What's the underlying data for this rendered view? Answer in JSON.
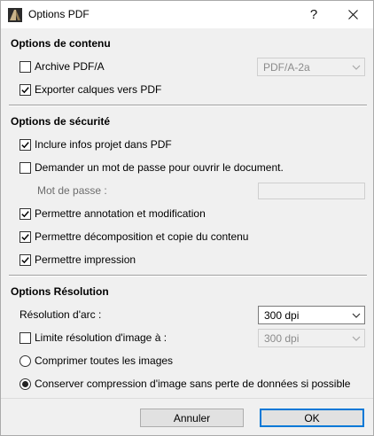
{
  "window": {
    "title": "Options PDF",
    "help_glyph": "?",
    "close_icon": "close-icon",
    "app_icon": "archicad-icon"
  },
  "content": {
    "title": "Options de contenu",
    "archive": {
      "label": "Archive PDF/A",
      "checked": false
    },
    "archive_select": {
      "value": "PDF/A-2a",
      "enabled": false
    },
    "export_layers": {
      "label": "Exporter calques vers PDF",
      "checked": true
    }
  },
  "security": {
    "title": "Options de sécurité",
    "include_info": {
      "label": "Inclure infos projet dans PDF",
      "checked": true
    },
    "ask_password": {
      "label": "Demander un mot de passe pour ouvrir le document.",
      "checked": false
    },
    "password_label": "Mot de passe :",
    "password_value": "",
    "allow_annotation": {
      "label": "Permettre annotation et modification",
      "checked": true
    },
    "allow_decomposition": {
      "label": "Permettre décomposition et copie du contenu",
      "checked": true
    },
    "allow_print": {
      "label": "Permettre impression",
      "checked": true
    }
  },
  "resolution": {
    "title": "Options Résolution",
    "arc_label": "Résolution d'arc :",
    "arc_value": "300 dpi",
    "limit": {
      "label": "Limite résolution d'image à :",
      "checked": false
    },
    "limit_value": "300 dpi",
    "compress_all": {
      "label": "Comprimer toutes les images",
      "selected": false
    },
    "keep_lossless": {
      "label": "Conserver compression d'image sans perte de données si possible",
      "selected": true
    }
  },
  "footer": {
    "cancel_label": "Annuler",
    "ok_label": "OK"
  }
}
